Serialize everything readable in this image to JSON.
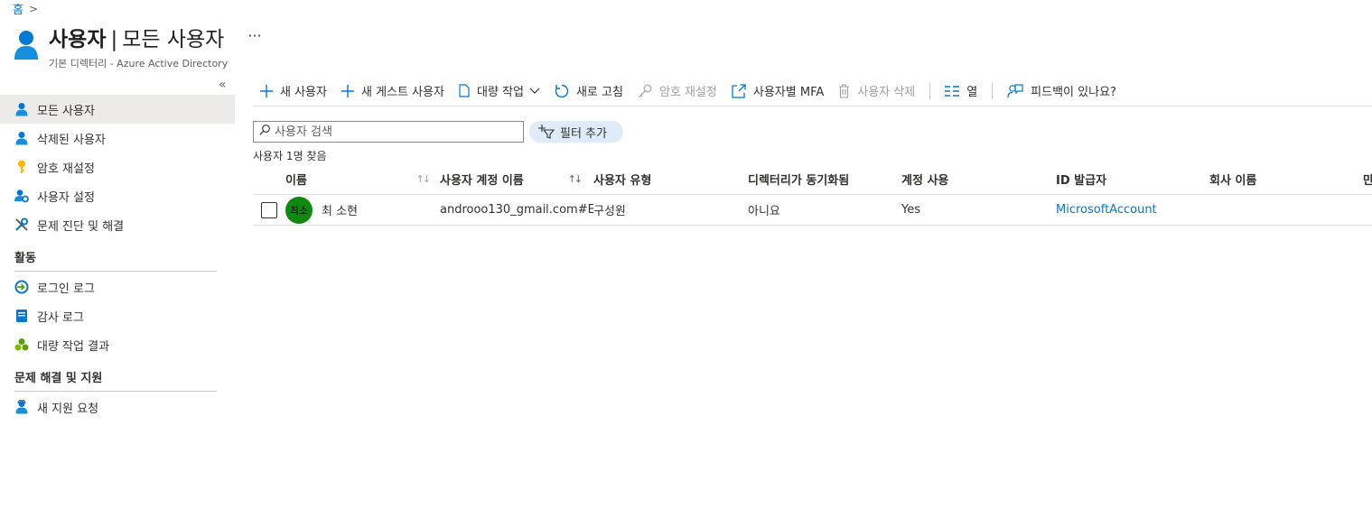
{
  "breadcrumb": {
    "home": "홈",
    "sep": ">"
  },
  "header": {
    "title_main": "사용자",
    "title_sep": "|",
    "title_sub": "모든 사용자",
    "more": "···",
    "subtitle": "기본 디렉터리 - Azure Active Directory"
  },
  "collapse": "«",
  "sidebar": {
    "items_top": [
      {
        "label": "모든 사용자",
        "icon": "user-icon"
      },
      {
        "label": "삭제된 사용자",
        "icon": "user-icon"
      },
      {
        "label": "암호 재설정",
        "icon": "key-icon"
      },
      {
        "label": "사용자 설정",
        "icon": "user-settings-icon"
      },
      {
        "label": "문제 진단 및 해결",
        "icon": "wrench-icon"
      }
    ],
    "section_activity": "활동",
    "items_activity": [
      {
        "label": "로그인 로그",
        "icon": "signin-log-icon"
      },
      {
        "label": "감사 로그",
        "icon": "audit-log-icon"
      },
      {
        "label": "대량 작업 결과",
        "icon": "bulk-results-icon"
      }
    ],
    "section_support": "문제 해결 및 지원",
    "items_support": [
      {
        "label": "새 지원 요청",
        "icon": "support-request-icon"
      }
    ]
  },
  "toolbar": {
    "new_user": "새 사용자",
    "new_guest": "새 게스트 사용자",
    "bulk": "대량 작업",
    "refresh": "새로 고침",
    "reset_password": "암호 재설정",
    "mfa": "사용자별 MFA",
    "delete": "사용자 삭제",
    "columns": "열",
    "feedback": "피드백이 있나요?"
  },
  "search": {
    "placeholder": "사용자 검색"
  },
  "filter": {
    "label": "필터 추가"
  },
  "result_count": "사용자 1명 찾음",
  "table": {
    "headers": {
      "name": "이름",
      "upn": "사용자 계정 이름",
      "type": "사용자 유형",
      "sync": "디렉터리가 동기화됨",
      "enabled": "계정 사용",
      "issuer": "ID 발급자",
      "company": "회사 이름",
      "extra": "만"
    },
    "rows": [
      {
        "avatar": "최소",
        "name": "최 소현",
        "upn": "androoo130_gmail.com#E…",
        "type": "구성원",
        "sync": "아니요",
        "enabled": "Yes",
        "issuer": "MicrosoftAccount",
        "company": ""
      }
    ]
  },
  "colors": {
    "accent": "#0078d4",
    "avatar_bg": "#0f8a0f",
    "active_nav_bg": "#edebe9",
    "pill_bg": "#deecf9"
  }
}
